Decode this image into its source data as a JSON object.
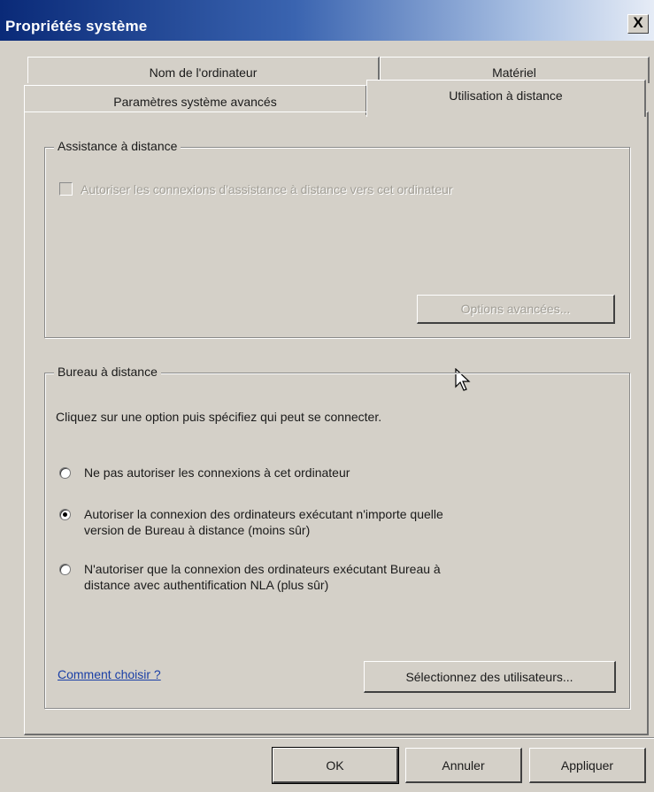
{
  "window": {
    "title": "Propriétés système",
    "close_label": "X"
  },
  "tabs": {
    "row1": [
      "Nom de l'ordinateur",
      "Matériel"
    ],
    "row2": [
      "Paramètres système avancés"
    ],
    "selected": "Utilisation à distance"
  },
  "remote_assistance": {
    "legend": "Assistance à distance",
    "checkbox_label": "Autoriser les connexions d'assistance à distance vers cet ordinateur",
    "checkbox_checked": false,
    "checkbox_enabled": false,
    "advanced_button": "Options avancées..."
  },
  "remote_desktop": {
    "legend": "Bureau à distance",
    "instruction": "Cliquez sur une option puis spécifiez qui peut se connecter.",
    "options": [
      {
        "line1": "Ne pas autoriser les connexions à cet ordinateur",
        "line2": "",
        "selected": false
      },
      {
        "line1": "Autoriser la connexion des ordinateurs exécutant n'importe quelle",
        "line2": "version de Bureau à distance (moins sûr)",
        "selected": true
      },
      {
        "line1": "N'autoriser que la connexion des ordinateurs exécutant Bureau à",
        "line2": "distance avec authentification NLA (plus sûr)",
        "selected": false
      }
    ],
    "help_link": "Comment choisir ?",
    "select_users_button": "Sélectionnez des utilisateurs..."
  },
  "footer": {
    "ok": "OK",
    "cancel": "Annuler",
    "apply": "Appliquer"
  }
}
